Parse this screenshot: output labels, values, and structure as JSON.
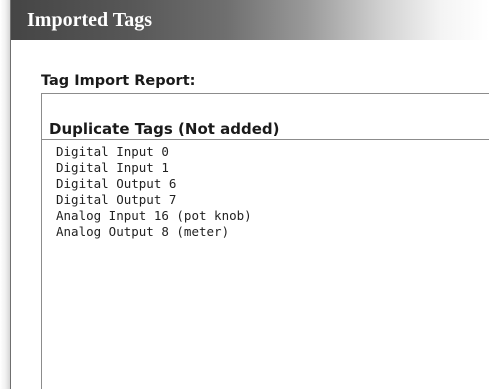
{
  "window": {
    "title": "Imported Tags"
  },
  "report": {
    "title": "Tag Import Report:",
    "section_heading": "Duplicate Tags (Not added)",
    "duplicate_tags": [
      "Digital Input 0",
      "Digital Input 1",
      "Digital Output 6",
      "Digital Output 7",
      "Analog Input 16 (pot knob)",
      "Analog Output 8 (meter)"
    ]
  }
}
